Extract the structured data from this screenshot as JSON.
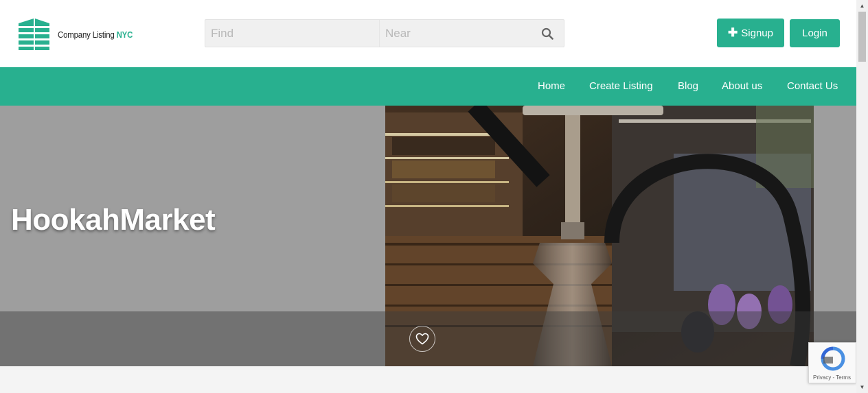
{
  "brand": {
    "name_part1": "Company Listing",
    "name_part2": "NYC",
    "accent_color": "#28b08f"
  },
  "search": {
    "find_placeholder": "Find",
    "near_placeholder": "Near",
    "icon": "search-icon"
  },
  "header": {
    "signup_label": "Signup",
    "login_label": "Login"
  },
  "nav": {
    "items": [
      {
        "label": "Home"
      },
      {
        "label": "Create Listing"
      },
      {
        "label": "Blog"
      },
      {
        "label": "About us"
      },
      {
        "label": "Contact Us"
      }
    ]
  },
  "listing": {
    "title": "HookahMarket",
    "favorite_icon": "heart-icon"
  },
  "recaptcha": {
    "label": "Privacy - Terms"
  }
}
